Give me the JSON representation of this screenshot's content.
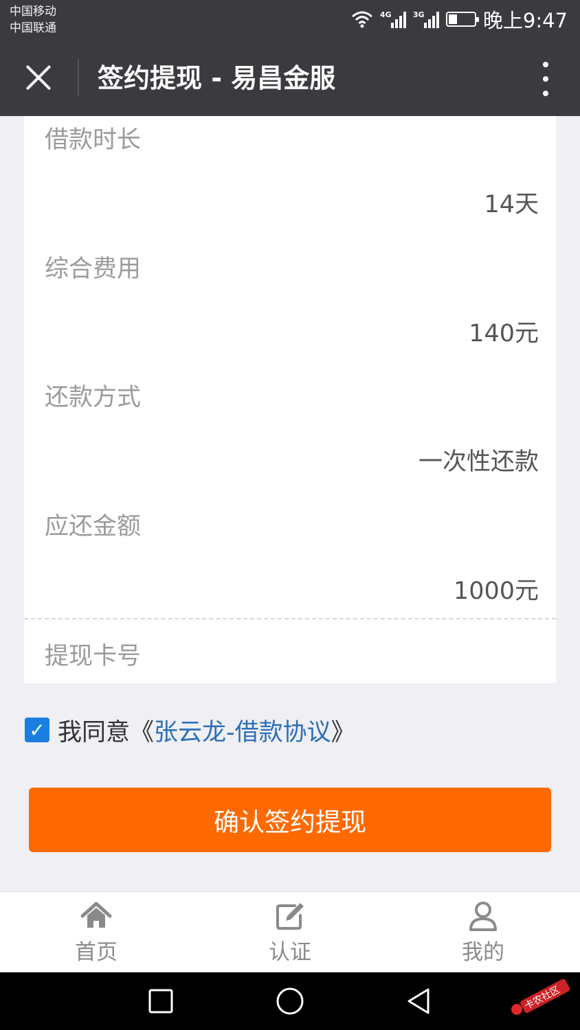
{
  "status_bar": {
    "carrier_1": "中国移动",
    "carrier_2": "中国联通",
    "signal_1_tag": "4G",
    "signal_2_tag": "3G",
    "time": "晚上9:47"
  },
  "nav": {
    "title": "签约提现 - 易昌金服"
  },
  "details": [
    {
      "label": "借款时长",
      "value": "14天"
    },
    {
      "label": "综合费用",
      "value": "140元"
    },
    {
      "label": "还款方式",
      "value": "一次性还款"
    },
    {
      "label": "应还金额",
      "value": "1000元"
    }
  ],
  "card_field": {
    "label": "提现卡号"
  },
  "agreement": {
    "checked": true,
    "prefix": "我同意",
    "open": "《",
    "link_text": "张云龙-借款协议",
    "close": "》"
  },
  "confirm_button": "确认签约提现",
  "tabs": [
    {
      "label": "首页",
      "icon": "home-icon"
    },
    {
      "label": "认证",
      "icon": "edit-icon"
    },
    {
      "label": "我的",
      "icon": "user-icon"
    }
  ],
  "system_nav": [
    "square-icon",
    "circle-icon",
    "back-triangle-icon"
  ],
  "watermark": "卡农社区",
  "colors": {
    "header_bg": "#3a3a3f",
    "accent_button": "#ff6a00",
    "checkbox": "#1a7fe0",
    "link": "#2d6fb8"
  }
}
